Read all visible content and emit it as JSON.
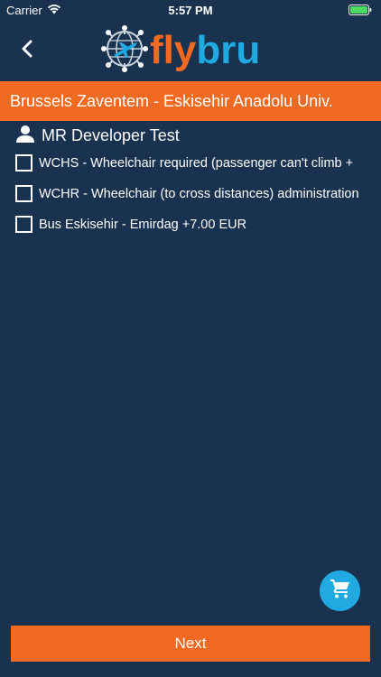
{
  "status_bar": {
    "carrier": "Carrier",
    "time": "5:57 PM",
    "battery_color": "#4cd964"
  },
  "nav": {
    "back_icon": "chevron-left-icon",
    "logo": {
      "emblem_icon": "globe-plane-icon",
      "text_part1": "fly",
      "text_part2": "bru",
      "color_part1": "#f26a21",
      "color_part2": "#21a9e1"
    }
  },
  "route": {
    "title": "Brussels Zaventem - Eskisehir Anadolu Univ.",
    "background": "#f26a21"
  },
  "passenger": {
    "icon": "person-icon",
    "name": "MR Developer Test"
  },
  "options": [
    {
      "label": "WCHS - Wheelchair required (passenger can't climb  +",
      "checked": false
    },
    {
      "label": "WCHR - Wheelchair (to cross distances) administration",
      "checked": false
    },
    {
      "label": "Bus Eskisehir - Emirdag +7.00 EUR",
      "checked": false
    }
  ],
  "cart": {
    "icon": "shopping-cart-icon",
    "color": "#21a9e1"
  },
  "footer": {
    "next_label": "Next"
  },
  "theme": {
    "background": "#19324f",
    "accent": "#f26a21"
  }
}
